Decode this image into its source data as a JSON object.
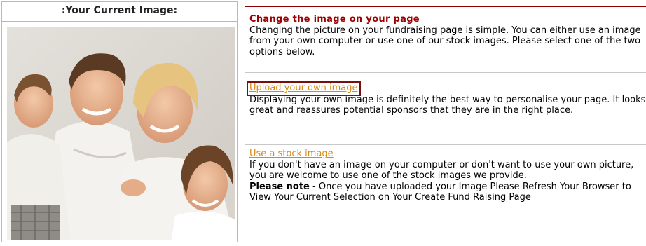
{
  "left_panel": {
    "header": ":Your Current Image:"
  },
  "intro": {
    "title": "Change the image on your page",
    "text": "Changing the picture on your fundraising page is simple. You can either use an image from your own computer or use one of our stock images. Please select one of the two options below."
  },
  "upload": {
    "link": "Upload your own image",
    "text": "Displaying your own image is definitely the best way to personalise your page. It looks great and reassures potential sponsors that they are in the right place."
  },
  "stock": {
    "link": "Use a stock image",
    "text": "If you don't have an image on your computer or don't want to use your own picture, you are welcome to use one of the stock images we provide.",
    "note_label": "Please note",
    "note_text": " - Once you have uploaded your Image Please Refresh Your Browser to View Your Current Selection on Your Create Fund Raising Page"
  },
  "colors": {
    "heading": "#9c0000",
    "link": "#d78a15",
    "outline": "#7a0d0d"
  }
}
